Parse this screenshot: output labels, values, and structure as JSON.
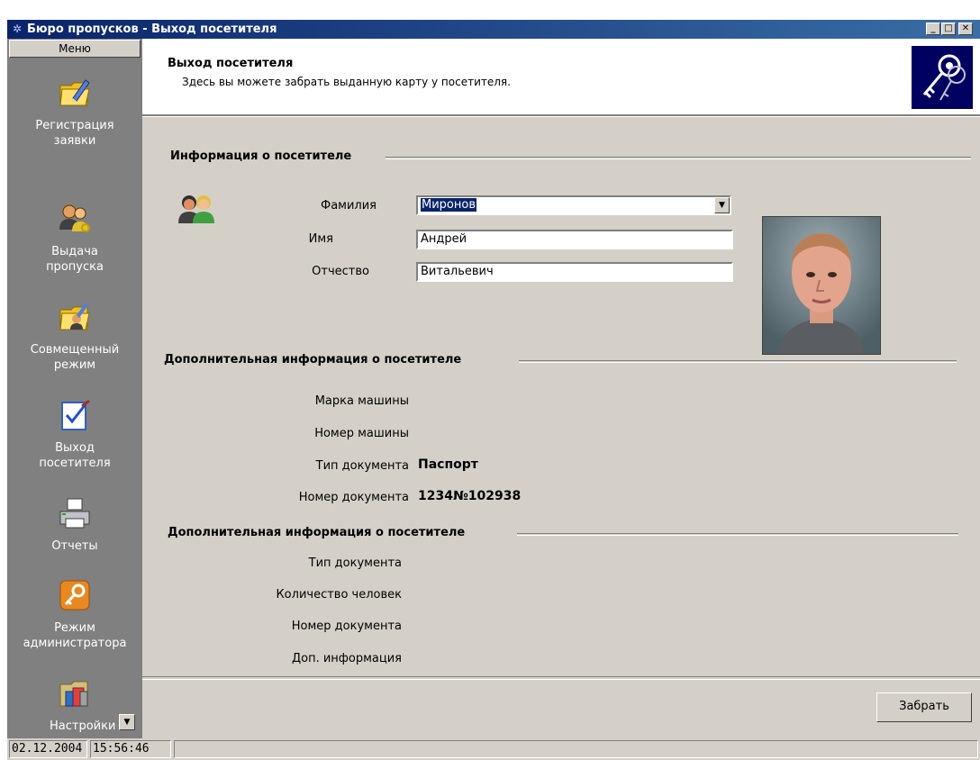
{
  "window": {
    "title": "Бюро пропусков - Выход посетителя",
    "controls": {
      "minimize": "_",
      "maximize": "□",
      "close": "✕"
    }
  },
  "sidebar": {
    "menu_label": "Меню",
    "items": [
      {
        "label_line1": "Регистрация",
        "label_line2": "заявки",
        "icon": "folder-pen-icon"
      },
      {
        "label_line1": "Выдача",
        "label_line2": "пропуска",
        "icon": "users-key-icon"
      },
      {
        "label_line1": "Совмещенный",
        "label_line2": "режим",
        "icon": "folder-users-icon"
      },
      {
        "label_line1": "Выход",
        "label_line2": "посетителя",
        "icon": "checklist-icon"
      },
      {
        "label_line1": "Отчеты",
        "label_line2": "",
        "icon": "printer-icon"
      },
      {
        "label_line1": "Режим",
        "label_line2": "администратора",
        "icon": "key-icon"
      },
      {
        "label_line1": "Настройки",
        "label_line2": "",
        "icon": "settings-folder-icon"
      }
    ]
  },
  "header": {
    "title": "Выход посетителя",
    "description": "Здесь вы можете забрать выданную карту у посетителя."
  },
  "visitor": {
    "section_title": "Информация о посетителе",
    "surname_label": "Фамилия",
    "surname_value": "Миронов",
    "name_label": "Имя",
    "name_value": "Андрей",
    "patronymic_label": "Отчество",
    "patronymic_value": "Витальевич"
  },
  "additional1": {
    "section_title": "Дополнительная информация о посетителе",
    "car_brand_label": "Марка машины",
    "car_number_label": "Номер машины",
    "doc_type_label": "Тип документа",
    "doc_type_value": "Паспорт",
    "doc_number_label": "Номер документа",
    "doc_number_value": "1234№102938"
  },
  "additional2": {
    "section_title": "Дополнительная информация о посетителе",
    "doc_type_label": "Тип документа",
    "people_count_label": "Количество человек",
    "doc_number_label": "Номер документа",
    "extra_info_label": "Доп. информация"
  },
  "actions": {
    "take_label": "Забрать"
  },
  "status": {
    "date": "02.12.2004",
    "time": "15:56:46"
  },
  "colors": {
    "title_bar": "#0a246a",
    "sidebar": "#808080",
    "dialog": "#d4d0c8",
    "selection": "#0a246a"
  }
}
